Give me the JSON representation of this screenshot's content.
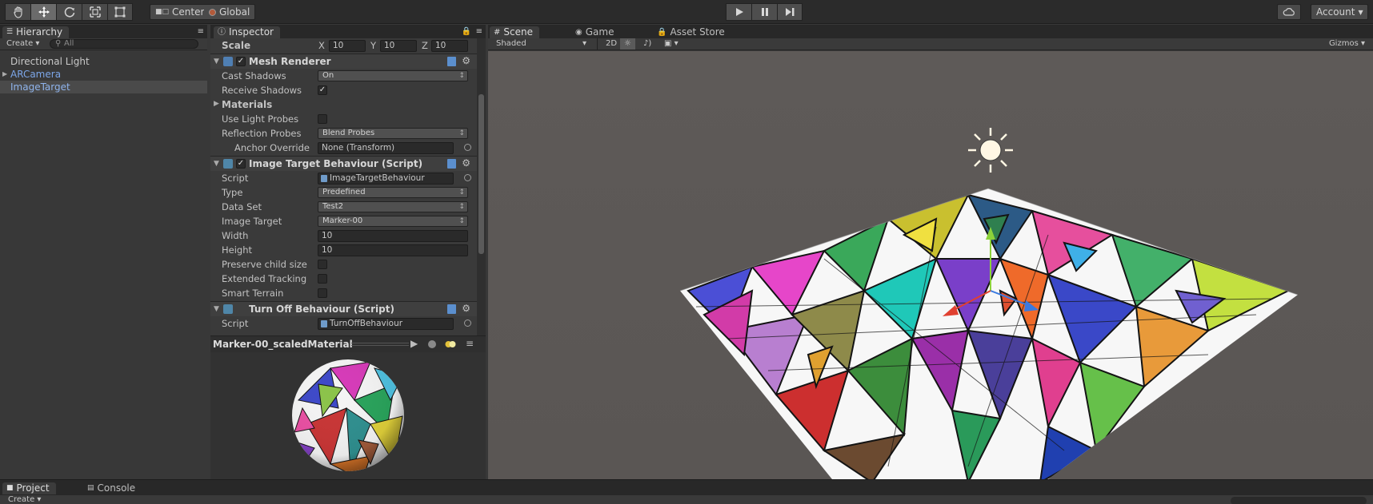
{
  "toolbar": {
    "center_label": "Center",
    "global_label": "Global",
    "account_label": "Account"
  },
  "hierarchy": {
    "tab_label": "Hierarchy",
    "create_label": "Create",
    "search_placeholder": "All",
    "items": [
      {
        "label": "Directional Light",
        "prefab": false,
        "selected": false
      },
      {
        "label": "ARCamera",
        "prefab": true,
        "selected": false
      },
      {
        "label": "ImageTarget",
        "prefab": false,
        "selected": true
      }
    ]
  },
  "inspector": {
    "tab_label": "Inspector",
    "scale": {
      "label": "Scale",
      "x_label": "X",
      "x": "10",
      "y_label": "Y",
      "y": "10",
      "z_label": "Z",
      "z": "10"
    },
    "mesh_renderer": {
      "title": "Mesh Renderer",
      "cast_shadows_label": "Cast Shadows",
      "cast_shadows_value": "On",
      "receive_shadows_label": "Receive Shadows",
      "materials_label": "Materials",
      "use_light_probes_label": "Use Light Probes",
      "reflection_probes_label": "Reflection Probes",
      "reflection_probes_value": "Blend Probes",
      "anchor_override_label": "Anchor Override",
      "anchor_override_value": "None (Transform)"
    },
    "image_target": {
      "title": "Image Target Behaviour (Script)",
      "script_label": "Script",
      "script_value": "ImageTargetBehaviour",
      "type_label": "Type",
      "type_value": "Predefined",
      "data_set_label": "Data Set",
      "data_set_value": "Test2",
      "image_target_label": "Image Target",
      "image_target_value": "Marker-00",
      "width_label": "Width",
      "width_value": "10",
      "height_label": "Height",
      "height_value": "10",
      "preserve_label": "Preserve child size",
      "extended_label": "Extended Tracking",
      "smart_label": "Smart Terrain"
    },
    "turn_off": {
      "title": "Turn Off Behaviour (Script)",
      "script_label": "Script",
      "script_value": "TurnOffBehaviour"
    },
    "material_preview": {
      "title": "Marker-00_scaledMaterial"
    }
  },
  "scene": {
    "tabs": [
      "Scene",
      "Game",
      "Asset Store"
    ],
    "shading": "Shaded",
    "mode_2d": "2D",
    "gizmos_label": "Gizmos"
  },
  "bottom": {
    "tabs": [
      "Project",
      "Console"
    ],
    "create_label": "Create"
  }
}
